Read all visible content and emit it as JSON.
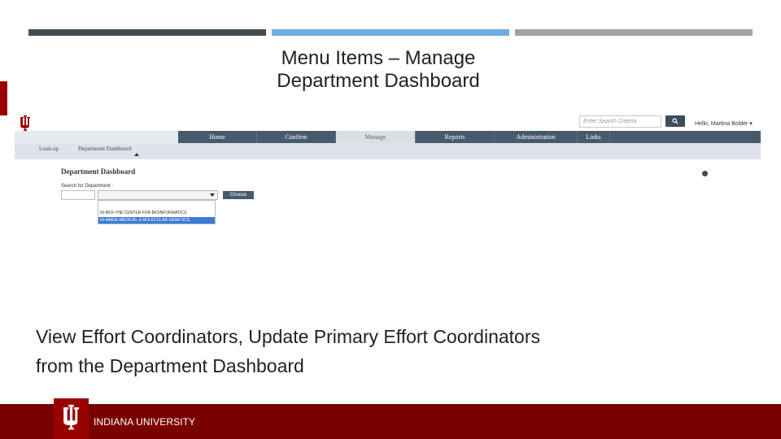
{
  "slide": {
    "title_line1": "Menu Items – Manage",
    "title_line2": "Department Dashboard",
    "body_line1": "View Effort Coordinators, Update Primary Effort Coordinators",
    "body_line2": "from the Department Dashboard",
    "footer_org": "INDIANA UNIVERSITY"
  },
  "colors": {
    "topbar": [
      "#414b52",
      "#6eaee0",
      "#9ea3a6"
    ],
    "iu_crimson": "#990000",
    "footer": "#7a0000",
    "nav": "#465a6c"
  },
  "app": {
    "logo_icon": "iu-trident-icon",
    "search_placeholder": "Enter Search Criteria",
    "search_icon": "search-icon",
    "user_greeting": "Hello, Martina Bolder ▾",
    "nav": [
      "Home",
      "Confirm",
      "Manage",
      "Reports",
      "Administration",
      "Links"
    ],
    "nav_active": "Manage",
    "subnav": [
      "Look-up",
      "Department Dashboard"
    ],
    "page_heading": "Department Dashboard",
    "help_icon": "help-icon",
    "search_label": "Search for Department :",
    "choose_label": "Choose",
    "dropdown_options": [
      "IN-BIOI-THE CENTER FOR BIOINFORMATICS",
      "IN-MMGE-MEDICAL & MOLECULAR GENETICS"
    ],
    "dropdown_selected": "IN-MMGE-MEDICAL & MOLECULAR GENETICS"
  }
}
